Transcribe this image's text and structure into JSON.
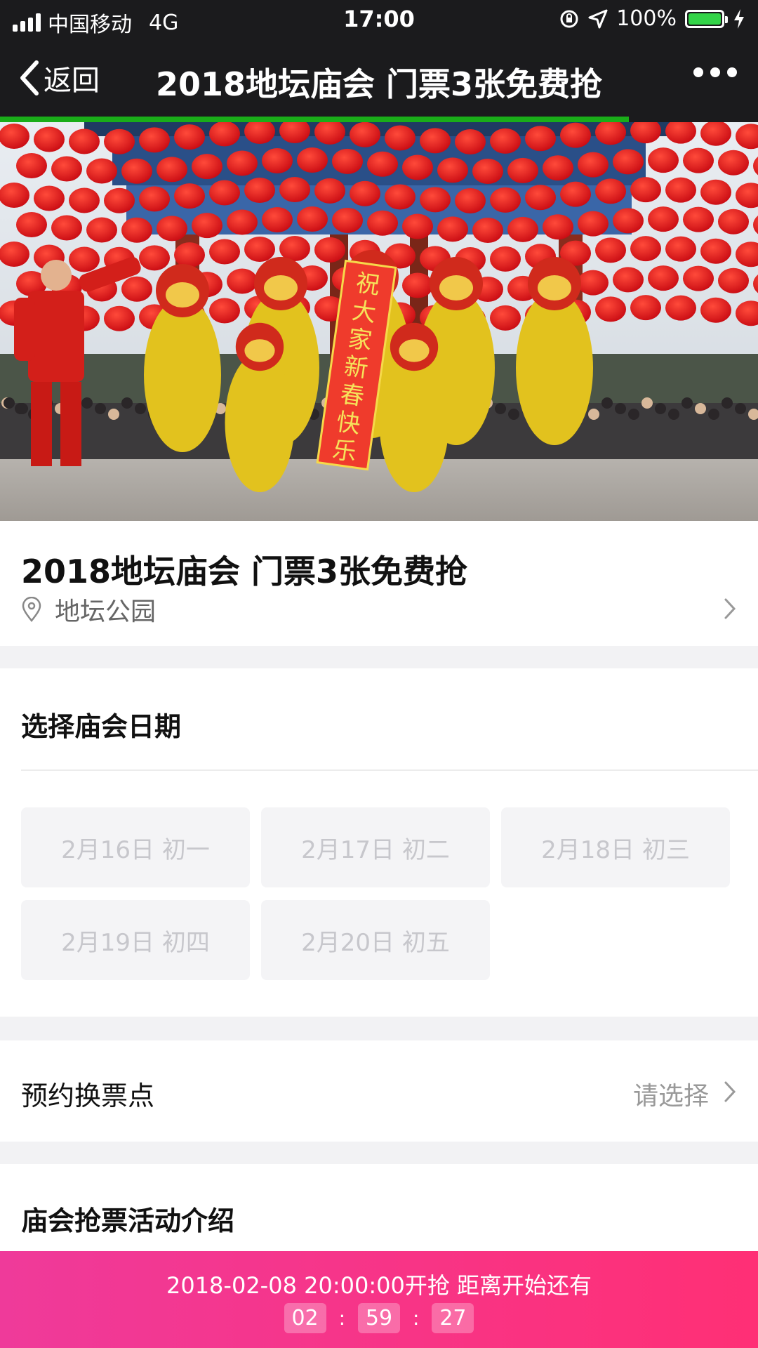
{
  "status_bar": {
    "carrier": "中国移动",
    "network": "4G",
    "time": "17:00",
    "battery": "100%",
    "battery_level": 1.0
  },
  "nav": {
    "back_label": "返回",
    "title": "2018地坛庙会 门票3张免费抢",
    "load_progress": 0.83
  },
  "event": {
    "title": "2018地坛庙会 门票3张免费抢",
    "location": "地坛公园"
  },
  "date_section": {
    "title": "选择庙会日期",
    "dates": [
      "2月16日 初一",
      "2月17日 初二",
      "2月18日 初三",
      "2月19日 初四",
      "2月20日 初五"
    ]
  },
  "pickup": {
    "label": "预约换票点",
    "value": "请选择"
  },
  "intro": {
    "title": "庙会抢票活动介绍"
  },
  "countdown": {
    "text": "2018-02-08 20:00:00开抢 距离开始还有",
    "hours": "02",
    "minutes": "59",
    "seconds": "27"
  },
  "banner": {
    "text": "祝大家新春快乐"
  },
  "colors": {
    "accent_green": "#1aad19",
    "bottom_start": "#ef3a9a",
    "bottom_end": "#ff2f75"
  }
}
